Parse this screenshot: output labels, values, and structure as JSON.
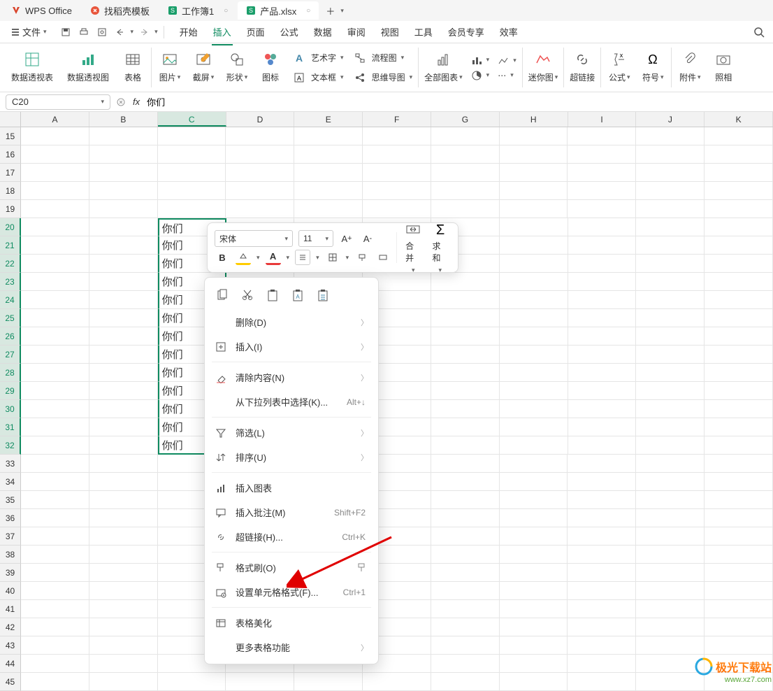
{
  "title_tabs": {
    "app": "WPS Office",
    "template": "找稻壳模板",
    "workbook": "工作簿1",
    "product": "产品.xlsx"
  },
  "menu": {
    "file": "文件",
    "qa_save": "⎙",
    "qa_print": "⎙",
    "tabs": [
      "开始",
      "插入",
      "页面",
      "公式",
      "数据",
      "审阅",
      "视图",
      "工具",
      "会员专享",
      "效率"
    ]
  },
  "ribbon": {
    "pivot_table": "数据透视表",
    "pivot_chart": "数据透视图",
    "table": "表格",
    "image": "图片",
    "screenshot": "截屏",
    "shapes": "形状",
    "icons": "图标",
    "wordart": "艺术字",
    "flowchart": "流程图",
    "textbox": "文本框",
    "mindmap": "思维导图",
    "all_charts": "全部图表",
    "sparklines": "迷你图",
    "hyperlink": "超链接",
    "formula": "公式",
    "symbol": "符号",
    "attachment": "附件",
    "camera": "照相"
  },
  "formula_bar": {
    "name_box": "C20",
    "fx": "fx",
    "value": "你们"
  },
  "grid": {
    "columns": [
      "A",
      "B",
      "C",
      "D",
      "E",
      "F",
      "G",
      "H",
      "I",
      "J",
      "K"
    ],
    "row_start": 15,
    "row_end": 45,
    "data_row_start": 20,
    "data_row_end": 32,
    "data_col": "C",
    "data_value": "你们"
  },
  "mini_toolbar": {
    "font": "宋体",
    "size": "11",
    "bold": "B",
    "fill": "⬛",
    "fontcolor": "A",
    "merge": "合并",
    "sum": "求和"
  },
  "context_menu": {
    "delete": "删除(D)",
    "insert": "插入(I)",
    "clear": "清除内容(N)",
    "dropdown_select": "从下拉列表中选择(K)...",
    "dropdown_hint": "Alt+↓",
    "filter": "筛选(L)",
    "sort": "排序(U)",
    "insert_chart": "插入图表",
    "insert_comment": "插入批注(M)",
    "comment_hint": "Shift+F2",
    "hyperlink": "超链接(H)...",
    "hyperlink_hint": "Ctrl+K",
    "format_painter": "格式刷(O)",
    "format_cells": "设置单元格格式(F)...",
    "format_cells_hint": "Ctrl+1",
    "beautify": "表格美化",
    "more": "更多表格功能"
  },
  "watermark": {
    "text": "极光下载站",
    "url": "www.xz7.com"
  }
}
